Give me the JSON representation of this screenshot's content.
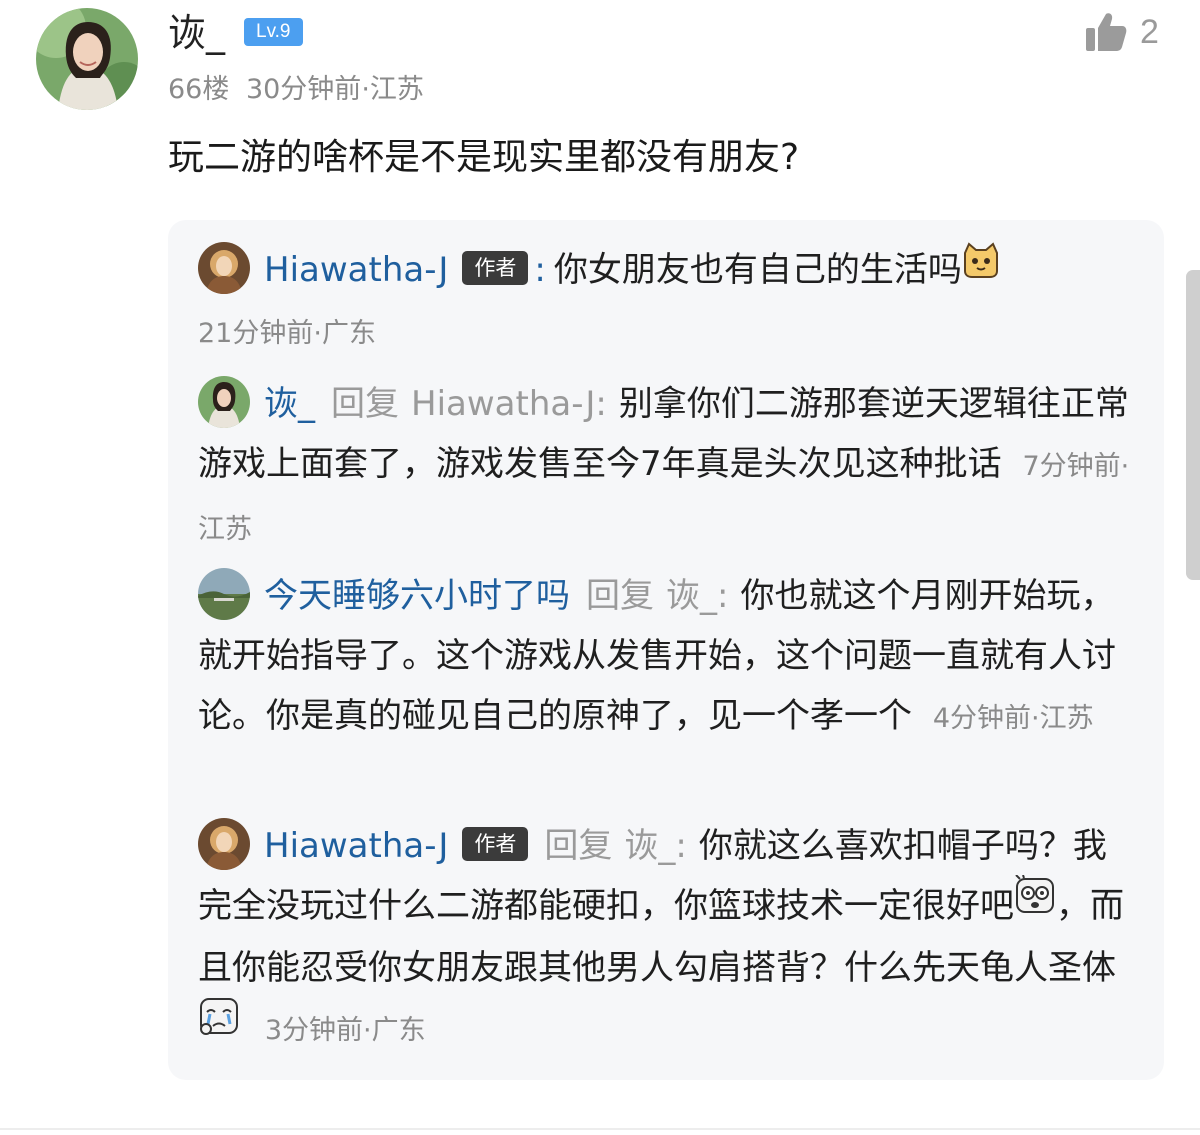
{
  "post": {
    "username": "诙_",
    "level": "Lv.9",
    "floor": "66楼",
    "time": "30分钟前",
    "location": "江苏",
    "like_count": "2",
    "content": "玩二游的啥杯是不是现实里都没有朋友?"
  },
  "replies": [
    {
      "username": "Hiawatha-J",
      "author_tag": "作者",
      "colon": ":",
      "text": "你女朋友也有自己的生活吗",
      "emoji": "cat-face-icon",
      "time": "21分钟前",
      "location": "广东"
    },
    {
      "username": "诙_",
      "reply_word": "回复",
      "reply_to": "Hiawatha-J:",
      "text": "别拿你们二游那套逆天逻辑往正常游戏上面套了，游戏发售至今7年真是头次见这种批话",
      "time": "7分钟前",
      "location": "江苏"
    },
    {
      "username": "今天睡够六小时了吗",
      "reply_word": "回复",
      "reply_to": "诙_:",
      "text": "你也就这个月刚开始玩，就开始指导了。这个游戏从发售开始，这个问题一直就有人讨论。你是真的碰见自己的原神了，见一个孝一个",
      "time": "4分钟前",
      "location": "江苏"
    },
    {
      "username": "Hiawatha-J",
      "author_tag": "作者",
      "reply_word": "回复",
      "reply_to": "诙_:",
      "text_1": "你就这么喜欢扣帽子吗？我完全没玩过什么二游都能硬扣，你篮球技术一定很好吧",
      "emoji_1": "shocked-face-icon",
      "text_2": "，而且你能忍受你女朋友跟其他男人勾肩搭背？什么先天龟人圣体",
      "emoji_2": "crying-face-icon",
      "time": "3分钟前",
      "location": "广东"
    }
  ],
  "meta_separator": "·",
  "colors": {
    "username_blue": "#1f5f9e",
    "level_badge": "#4c9ff0",
    "meta_grey": "#8a8a8a",
    "reply_bg": "#f6f7f9"
  }
}
